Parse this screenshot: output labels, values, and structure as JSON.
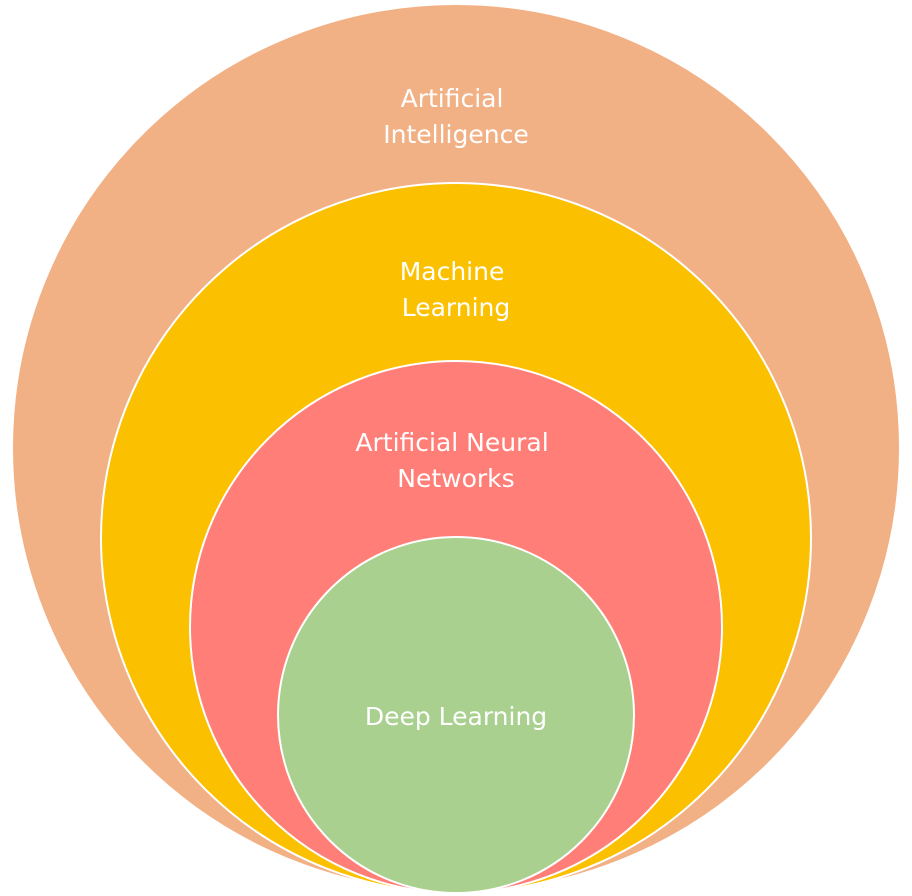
{
  "diagram": {
    "layers": [
      {
        "key": "ai",
        "lines": [
          "Artificial",
          "Intelligence"
        ],
        "color": "#F2B085"
      },
      {
        "key": "ml",
        "lines": [
          "Machine",
          "Learning"
        ],
        "color": "#FBC000"
      },
      {
        "key": "ann",
        "lines": [
          "Artificial Neural",
          "Networks"
        ],
        "color": "#FF7E78"
      },
      {
        "key": "dl",
        "lines": [
          "Deep Learning"
        ],
        "color": "#A9D08E"
      }
    ]
  }
}
